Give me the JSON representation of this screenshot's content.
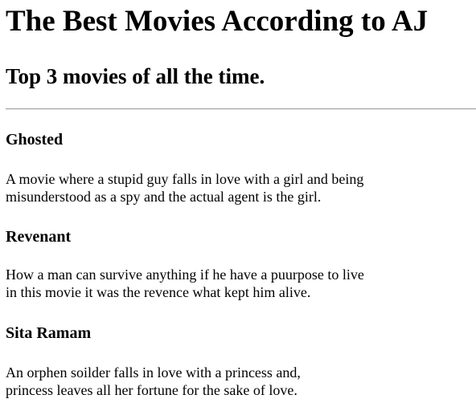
{
  "header": {
    "title": "The Best Movies According to AJ",
    "subtitle": "Top 3 movies of all the time."
  },
  "movies": [
    {
      "title": "Ghosted",
      "description_lines": [
        "A movie where a stupid guy falls in love with a girl and being",
        "misunderstood as a spy and the actual agent is the girl."
      ]
    },
    {
      "title": "Revenant",
      "description_lines": [
        "How a man can survive anything if he have a puurpose to live",
        "in this movie it was the revence what kept him alive."
      ]
    },
    {
      "title": "Sita Ramam",
      "description_lines": [
        "An orphen soilder falls in love with a princess and,",
        "princess leaves all her fortune for the sake of love."
      ]
    }
  ]
}
